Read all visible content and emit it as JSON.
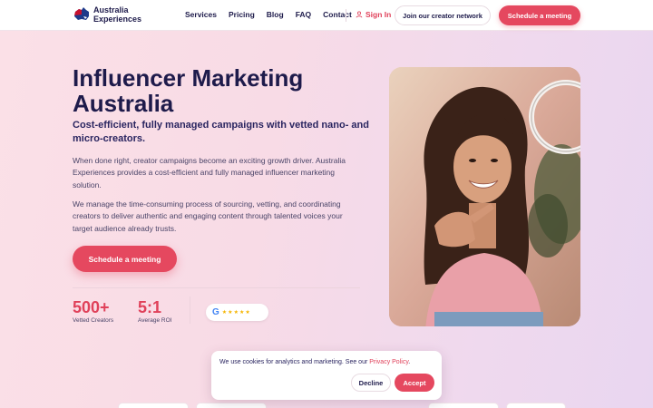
{
  "brand": {
    "name_line1": "Australia",
    "name_line2": "Experiences"
  },
  "nav": {
    "items": [
      "Services",
      "Pricing",
      "Blog",
      "FAQ",
      "Contact"
    ],
    "signin_label": "Sign In",
    "join_label": "Join our creator network",
    "schedule_label": "Schedule a meeting"
  },
  "hero": {
    "title": "Influencer Marketing Australia",
    "subtitle": "Cost-efficient, fully managed campaigns with vetted nano- and micro-creators.",
    "paragraph1": "When done right, creator campaigns become an exciting growth driver. Australia Experiences provides a cost-efficient and fully managed influencer marketing solution.",
    "paragraph2": "We manage the time-consuming process of sourcing, vetting, and coordinating creators to deliver authentic and engaging content through talented voices your target audience already trusts.",
    "cta_label": "Schedule a meeting"
  },
  "stats": [
    {
      "value": "500+",
      "label": "Vetted Creators"
    },
    {
      "value": "5:1",
      "label": "Average ROI"
    }
  ],
  "reviews": {
    "provider_glyph": "G",
    "stars": 5
  },
  "cookie": {
    "text": "We use cookies for analytics and marketing. See our",
    "link_label": "Privacy Policy",
    "decline_label": "Decline",
    "accept_label": "Accept"
  },
  "colors": {
    "accent": "#e5485f",
    "heading": "#1e1b4b"
  }
}
